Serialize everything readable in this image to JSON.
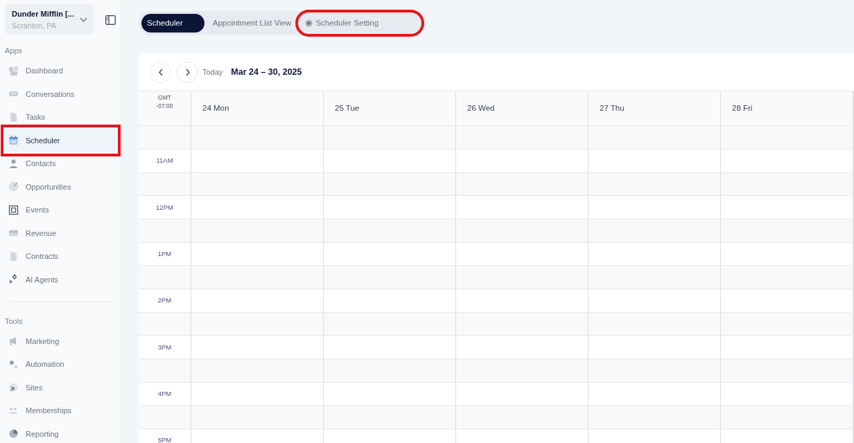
{
  "sidebar": {
    "account": {
      "name": "Dunder Mifflin [...",
      "location": "Scranton, PA"
    },
    "sections": [
      {
        "title": "Apps",
        "items": [
          {
            "label": "Dashboard",
            "selected": false,
            "highlighted": false
          },
          {
            "label": "Conversations",
            "selected": false,
            "highlighted": false
          },
          {
            "label": "Tasks",
            "selected": false,
            "highlighted": false
          },
          {
            "label": "Scheduler",
            "selected": true,
            "highlighted": true
          },
          {
            "label": "Contacts",
            "selected": false,
            "highlighted": false
          },
          {
            "label": "Opportunities",
            "selected": false,
            "highlighted": false
          },
          {
            "label": "Events",
            "selected": false,
            "highlighted": false
          },
          {
            "label": "Revenue",
            "selected": false,
            "highlighted": false
          },
          {
            "label": "Contracts",
            "selected": false,
            "highlighted": false
          },
          {
            "label": "AI Agents",
            "selected": false,
            "highlighted": false
          }
        ]
      },
      {
        "title": "Tools",
        "items": [
          {
            "label": "Marketing",
            "selected": false,
            "highlighted": false
          },
          {
            "label": "Automation",
            "selected": false,
            "highlighted": false
          },
          {
            "label": "Sites",
            "selected": false,
            "highlighted": false
          },
          {
            "label": "Memberships",
            "selected": false,
            "highlighted": false
          },
          {
            "label": "Reporting",
            "selected": false,
            "highlighted": false
          }
        ]
      }
    ]
  },
  "tabs": [
    {
      "label": "Scheduler",
      "selected": true,
      "highlighted": false
    },
    {
      "label": "Appointment List View",
      "selected": false,
      "highlighted": false
    },
    {
      "label": "Scheduler Setting",
      "selected": false,
      "highlighted": true
    }
  ],
  "calendar": {
    "today": "Today",
    "range": "Mar 24 – 30, 2025",
    "timezone": [
      "GMT",
      "-07:00"
    ],
    "days": [
      "24 Mon",
      "25 Tue",
      "26 Wed",
      "27 Thu",
      "28 Fri"
    ],
    "slots": [
      {
        "kind": "half"
      },
      {
        "kind": "hour",
        "label": "11AM"
      },
      {
        "kind": "half"
      },
      {
        "kind": "hour",
        "label": "12PM"
      },
      {
        "kind": "half"
      },
      {
        "kind": "hour",
        "label": "1PM"
      },
      {
        "kind": "half"
      },
      {
        "kind": "hour",
        "label": "2PM"
      },
      {
        "kind": "half"
      },
      {
        "kind": "hour",
        "label": "3PM"
      },
      {
        "kind": "half"
      },
      {
        "kind": "hour",
        "label": "4PM"
      },
      {
        "kind": "half"
      },
      {
        "kind": "hour",
        "label": "5PM"
      }
    ]
  }
}
